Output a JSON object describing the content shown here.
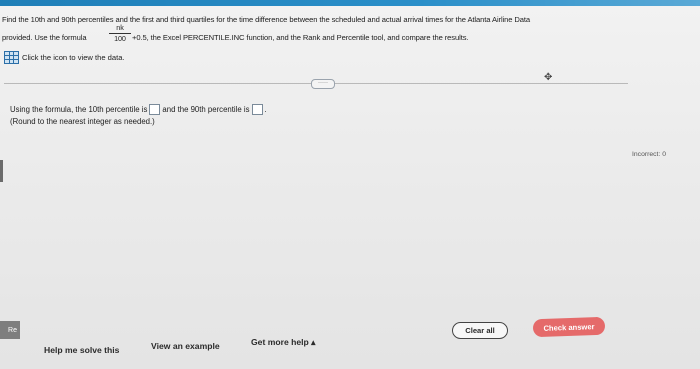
{
  "question": {
    "line1": "Find the 10th and 90th percentiles and the first and third quartiles for the time difference between the scheduled and actual arrival times for the Atlanta Airline Data",
    "line2_left": "provided. Use the formula",
    "fraction_numerator": "nk",
    "fraction_denominator": "100",
    "line2_right": "+0.5, the Excel PERCENTILE.INC function, and the Rank and Percentile tool, and compare the results.",
    "data_link_label": "Click the icon to view the data."
  },
  "toolbar": {
    "dots_label": "·····",
    "move_handle": "✥"
  },
  "answer": {
    "prefix": "Using the formula, the 10th percentile is",
    "middle": "and the 90th percentile is",
    "suffix": ".",
    "hint": "(Round to the nearest integer as needed.)",
    "box1_value": "",
    "box2_value": ""
  },
  "status": {
    "incorrect_label": "Incorrect: 0"
  },
  "left_tab_label": "Re",
  "buttons": {
    "clear_all": "Clear all",
    "check_answer": "Check answer"
  },
  "links": {
    "help_me_solve": "Help me solve this",
    "view_example": "View an example",
    "get_more_help": "Get more help ▴"
  },
  "colors": {
    "accent": "#1f7fb8",
    "check_button": "#e56a6a"
  },
  "icons": {
    "data_table": "table-icon",
    "move": "move-icon"
  }
}
